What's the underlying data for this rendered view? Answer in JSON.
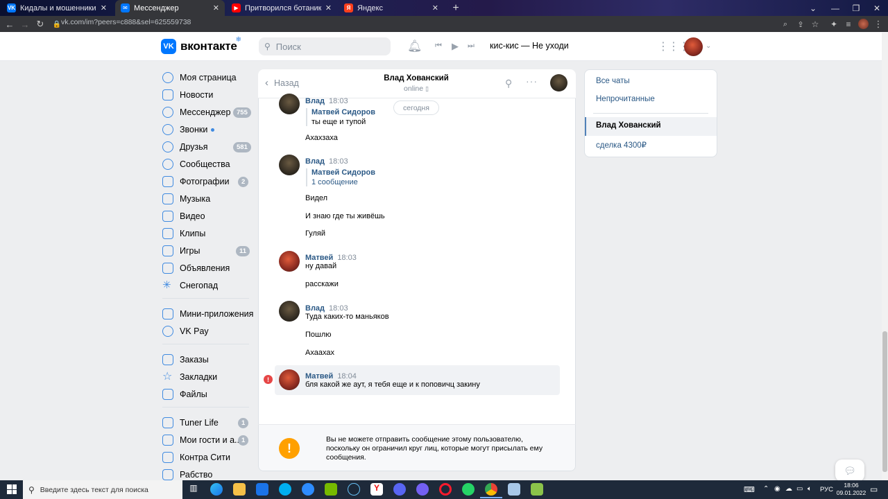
{
  "browser": {
    "tabs": [
      {
        "title": "Кидалы и мошенники в vk.com",
        "active": false,
        "favicon": "vk-icon"
      },
      {
        "title": "Мессенджер",
        "active": true,
        "favicon": "vk-messenger-icon"
      },
      {
        "title": "Притворился ботаником и реш",
        "active": false,
        "favicon": "youtube-icon"
      },
      {
        "title": "Яндекс",
        "active": false,
        "favicon": "yandex-icon"
      }
    ],
    "url": "vk.com/im?peers=c888&sel=625559738"
  },
  "header": {
    "logo_text": "вконтакте",
    "search_placeholder": "Поиск",
    "now_playing": "кис-кис — Не уходи"
  },
  "sidebar": {
    "items": [
      {
        "label": "Моя страница",
        "badge": ""
      },
      {
        "label": "Новости",
        "badge": ""
      },
      {
        "label": "Мессенджер",
        "badge": "755"
      },
      {
        "label": "Звонки",
        "badge": ""
      },
      {
        "label": "Друзья",
        "badge": "581"
      },
      {
        "label": "Сообщества",
        "badge": ""
      },
      {
        "label": "Фотографии",
        "badge": "2"
      },
      {
        "label": "Музыка",
        "badge": ""
      },
      {
        "label": "Видео",
        "badge": ""
      },
      {
        "label": "Клипы",
        "badge": ""
      },
      {
        "label": "Игры",
        "badge": "11"
      },
      {
        "label": "Объявления",
        "badge": ""
      },
      {
        "label": "Снегопад",
        "badge": ""
      },
      {
        "label": "Мини-приложения",
        "badge": ""
      },
      {
        "label": "VK Pay",
        "badge": ""
      },
      {
        "label": "Заказы",
        "badge": ""
      },
      {
        "label": "Закладки",
        "badge": ""
      },
      {
        "label": "Файлы",
        "badge": ""
      },
      {
        "label": "Tuner Life",
        "badge": "1"
      },
      {
        "label": "Мои гости и а...",
        "badge": "1"
      },
      {
        "label": "Контра Сити",
        "badge": ""
      },
      {
        "label": "Рабство",
        "badge": ""
      }
    ]
  },
  "chat": {
    "back_label": "Назад",
    "peer_name": "Влад Хованский",
    "peer_status": "online",
    "date_divider": "сегодня",
    "groups": [
      {
        "author": "Влад",
        "time": "18:03",
        "quote_author": "Матвей Сидоров",
        "quote_text": "ты еще и тупой",
        "lines": [
          "Ахахзаха"
        ]
      },
      {
        "author": "Влад",
        "time": "18:03",
        "quote_author": "Матвей Сидоров",
        "quote_text": "1 сообщение",
        "lines": [
          "Видел",
          "И знаю где ты живёшь",
          "Гуляй"
        ]
      },
      {
        "author": "Матвей",
        "time": "18:03",
        "lines": [
          "ну давай",
          "расскажи"
        ]
      },
      {
        "author": "Влад",
        "time": "18:03",
        "lines": [
          "Туда каких-то маньяков",
          "Пошлю",
          "Ахаахах"
        ]
      },
      {
        "author": "Матвей",
        "time": "18:04",
        "lines": [
          "бля какой же аут, я тебя еще и к поповичц закину"
        ]
      }
    ],
    "blocked_notice": "Вы не можете отправить сообщение этому пользователю, поскольку он ограничил круг лиц, которые могут присылать ему сообщения."
  },
  "right_panel": {
    "filters": [
      "Все чаты",
      "Непрочитанные"
    ],
    "chats": [
      "Влад Хованский",
      "сделка 4300₽"
    ]
  },
  "taskbar": {
    "search_placeholder": "Введите здесь текст для поиска",
    "lang": "РУС",
    "time": "18:06",
    "date": "09.01.2022"
  },
  "colors": {
    "accent": "#0077ff",
    "link": "#2a5885",
    "badge": "#aeb7c2",
    "error": "#e64646",
    "warning": "#ffa000"
  }
}
